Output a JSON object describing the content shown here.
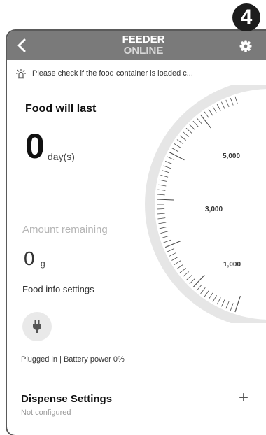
{
  "callout": {
    "number": "4"
  },
  "header": {
    "title": "FEEDER",
    "status": "ONLINE",
    "back_icon": "chevron-left-icon",
    "settings_icon": "gear-icon"
  },
  "notice": {
    "icon": "alert-light-icon",
    "text": "Please check if the food container is loaded c..."
  },
  "food": {
    "label": "Food will last",
    "days_value": "0",
    "days_unit": "day(s)"
  },
  "amount": {
    "label": "Amount remaining",
    "value": "0",
    "unit": "g"
  },
  "food_info_link": "Food info settings",
  "power": {
    "icon": "plug-icon",
    "status": "Plugged in | Battery power 0%"
  },
  "gauge": {
    "tick_labels": [
      "5,000",
      "3,000",
      "1,000"
    ]
  },
  "dispense": {
    "title": "Dispense Settings",
    "subtitle": "Not configured",
    "add_icon": "plus-icon",
    "add_label": "+"
  },
  "colors": {
    "header_bg": "#7a7a7a",
    "gauge_ring": "#e6e6e6",
    "callout_bg": "#1d1d1d"
  }
}
